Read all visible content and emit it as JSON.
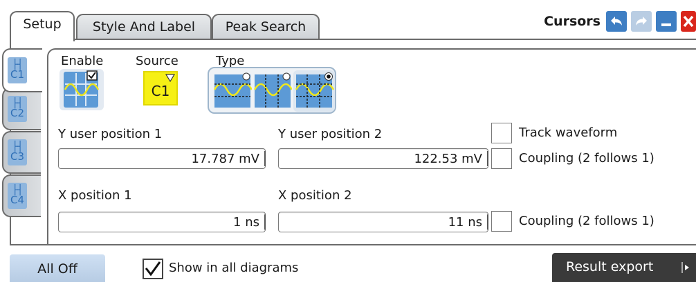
{
  "tabs": [
    {
      "label": "Setup"
    },
    {
      "label": "Style And Label"
    },
    {
      "label": "Peak Search"
    }
  ],
  "title": "Cursors",
  "cursor_tabs": [
    {
      "label": "C1"
    },
    {
      "label": "C2"
    },
    {
      "label": "C3"
    },
    {
      "label": "C4"
    }
  ],
  "enable": {
    "label": "Enable",
    "checked": true
  },
  "source": {
    "label": "Source",
    "value": "C1"
  },
  "type": {
    "label": "Type",
    "selected": "vertical-and-horizontal"
  },
  "y_pos1": {
    "label": "Y user position 1",
    "value": "17.787 mV"
  },
  "y_pos2": {
    "label": "Y user position 2",
    "value": "122.53 mV"
  },
  "track_waveform": {
    "label": "Track waveform",
    "checked": false
  },
  "coupling_y": {
    "label": "Coupling (2 follows 1)",
    "checked": false
  },
  "x_pos1": {
    "label": "X position 1",
    "value": "1 ns"
  },
  "x_pos2": {
    "label": "X position 2",
    "value": "11 ns"
  },
  "coupling_x": {
    "label": "Coupling (2 follows 1)",
    "checked": false
  },
  "bottom": {
    "all_off": "All Off",
    "show_all": {
      "label": "Show in all diagrams",
      "checked": true
    },
    "export": "Result export"
  },
  "colors": {
    "accent": "#3e7ec3",
    "source": "#f6f015",
    "close": "#d9261c",
    "waveform": "#e0d800"
  }
}
